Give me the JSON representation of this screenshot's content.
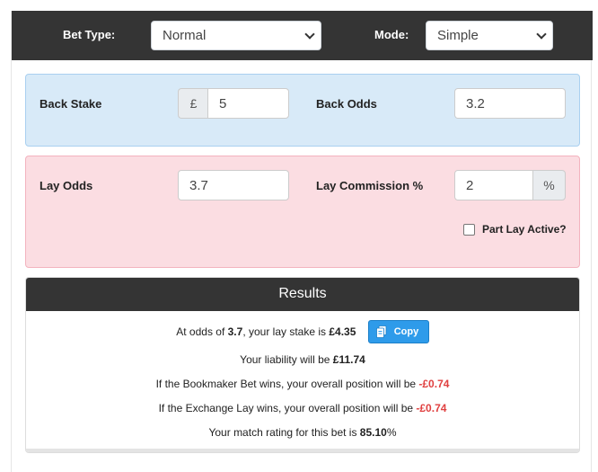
{
  "topbar": {
    "bet_type_label": "Bet Type:",
    "bet_type_value": "Normal",
    "mode_label": "Mode:",
    "mode_value": "Simple"
  },
  "back": {
    "stake_label": "Back Stake",
    "currency": "£",
    "stake_value": "5",
    "odds_label": "Back Odds",
    "odds_value": "3.2"
  },
  "lay": {
    "odds_label": "Lay Odds",
    "odds_value": "3.7",
    "commission_label": "Lay Commission %",
    "commission_value": "2",
    "percent": "%",
    "part_lay_label": "Part Lay Active?"
  },
  "results": {
    "title": "Results",
    "line1_pre": "At odds of ",
    "line1_odds": "3.7",
    "line1_mid": ", your lay stake is ",
    "line1_stake": "£4.35",
    "copy_label": "Copy",
    "line2_pre": "Your liability will be ",
    "line2_value": "£11.74",
    "line3_pre": "If the Bookmaker Bet wins, your overall position will be ",
    "line3_value": "-£0.74",
    "line4_pre": "If the Exchange Lay wins, your overall position will be ",
    "line4_value": "-£0.74",
    "line5_pre": "Your match rating for this bet is ",
    "line5_value": "85.10",
    "line5_suffix": "%"
  },
  "colors": {
    "header_bg": "#343434",
    "back_panel": "#d8eaf8",
    "lay_panel": "#fbdde2",
    "copy_button": "#2e9bea",
    "negative": "#e04040"
  }
}
